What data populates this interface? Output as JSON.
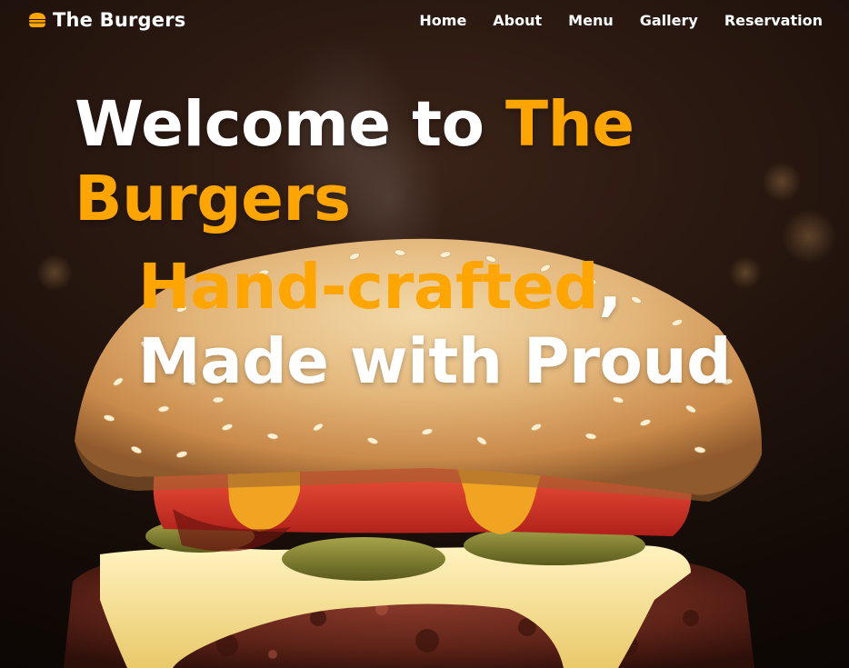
{
  "brand": {
    "name": "The Burgers",
    "icon": "burger-icon"
  },
  "nav": {
    "items": [
      {
        "label": "Home"
      },
      {
        "label": "About"
      },
      {
        "label": "Menu"
      },
      {
        "label": "Gallery"
      },
      {
        "label": "Reservation"
      }
    ]
  },
  "hero": {
    "headline_prefix": "Welcome to",
    "headline_accent": "The Burgers",
    "subline_accent": "Hand-crafted",
    "subline_comma": ",",
    "subline_rest": "Made with Proud",
    "background_image": "burger-photo"
  },
  "colors": {
    "accent": "#ffa500",
    "text": "#ffffff",
    "background": "#1a0f0a"
  }
}
